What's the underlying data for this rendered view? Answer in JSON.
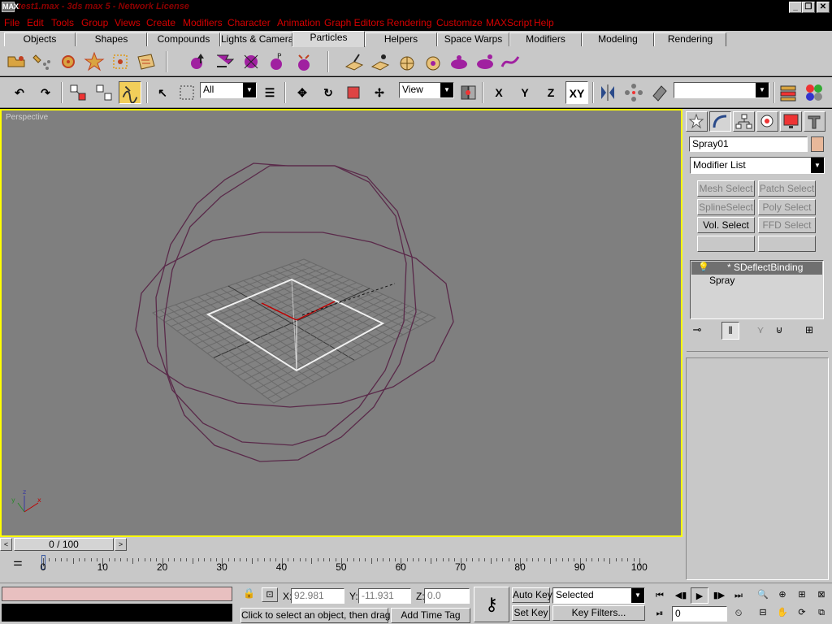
{
  "window": {
    "title": "test1.max - 3ds max 5 - Network License",
    "app_icon": "MAX"
  },
  "menu": [
    "File",
    "Edit",
    "Tools",
    "Group",
    "Views",
    "Create",
    "Modifiers",
    "Character",
    "Animation",
    "Graph Editors",
    "Rendering",
    "Customize",
    "MAXScript",
    "Help"
  ],
  "tabs": [
    "Objects",
    "Shapes",
    "Compounds",
    "Lights & Cameras",
    "Particles",
    "Helpers",
    "Space Warps",
    "Modifiers",
    "Modeling",
    "Rendering"
  ],
  "active_tab": "Particles",
  "main_toolbar": {
    "selection_filter": "All",
    "reference_coord": "View",
    "axis_x": "X",
    "axis_y": "Y",
    "axis_z": "Z",
    "axis_xy": "XY",
    "named_selection": ""
  },
  "viewport": {
    "label": "Perspective",
    "frame_color": "#ffff00",
    "axis_x": "x",
    "axis_y": "y",
    "axis_z": "z"
  },
  "command_panel": {
    "object_name": "Spray01",
    "object_color": "#e8b89a",
    "modifier_list": "Modifier List",
    "modifier_sets": [
      "Mesh Select",
      "Patch Select",
      "SplineSelect",
      "Poly Select",
      "Vol. Select",
      "FFD Select",
      "",
      ""
    ],
    "stack": [
      {
        "name": "* SDeflectBinding",
        "selected": true
      },
      {
        "name": "Spray",
        "selected": false
      }
    ]
  },
  "time": {
    "slider": "0 / 100",
    "ticks": [
      "0",
      "10",
      "20",
      "30",
      "40",
      "50",
      "60",
      "70",
      "80",
      "90",
      "100"
    ]
  },
  "status": {
    "prompt": "Click to select an object, then drag to",
    "add_time_tag": "Add Time Tag",
    "x_label": "X:",
    "x": "92.981",
    "y_label": "Y:",
    "y": "-11.931",
    "z_label": "Z:",
    "z": "0.0",
    "auto_key": "Auto Key",
    "set_key": "Set Key",
    "key_mode": "Selected",
    "key_filters": "Key Filters...",
    "frame": "0"
  },
  "colors": {
    "accent": "#f2ce5a",
    "menu_text": "#d60000",
    "gizmo": "#5a2a4a"
  }
}
